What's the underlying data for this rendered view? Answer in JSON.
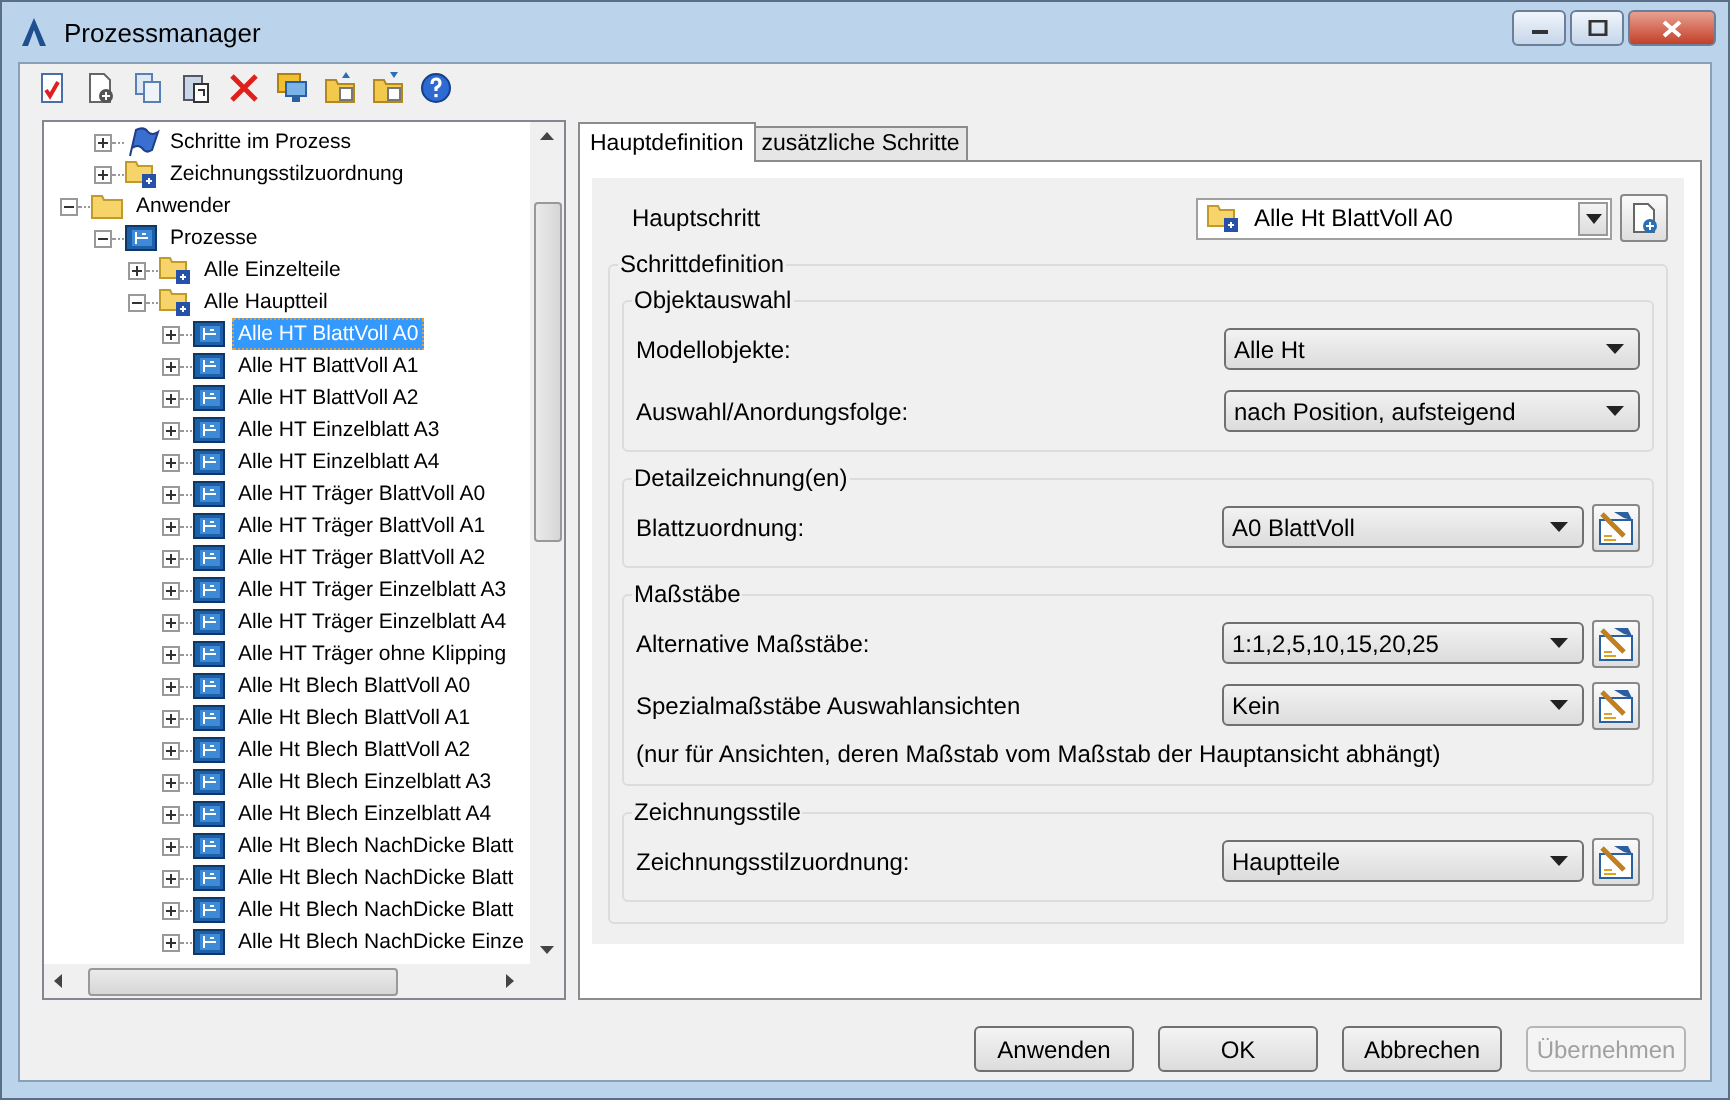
{
  "window": {
    "title": "Prozessmanager"
  },
  "toolbar": [
    {
      "kind": "check"
    },
    {
      "kind": "new"
    },
    {
      "kind": "copy"
    },
    {
      "kind": "paste"
    },
    {
      "kind": "delete"
    },
    {
      "kind": "monitor"
    },
    {
      "kind": "export"
    },
    {
      "kind": "import"
    },
    {
      "kind": "help"
    }
  ],
  "tree": {
    "partial_branch": [
      {
        "label": "Schritte im Prozess",
        "kind": "flag",
        "expanded": false,
        "selected": false
      },
      {
        "label": "Zeichnungsstilzuordnung",
        "kind": "folder-doc",
        "expanded": false,
        "selected": false
      }
    ],
    "items": [
      {
        "label": "Anwender",
        "kind": "folder",
        "expanded": true,
        "selected": false,
        "children": [
          {
            "label": "Prozesse",
            "kind": "process",
            "expanded": true,
            "selected": false,
            "children": [
              {
                "label": "Alle Einzelteile",
                "kind": "folder-doc",
                "expanded": false,
                "selected": false
              },
              {
                "label": "Alle Hauptteil",
                "kind": "folder-doc",
                "expanded": true,
                "selected": false,
                "children": [
                  {
                    "label": "Alle HT BlattVoll A0",
                    "kind": "process",
                    "expanded": false,
                    "selected": true
                  },
                  {
                    "label": "Alle HT BlattVoll A1",
                    "kind": "process",
                    "expanded": false,
                    "selected": false
                  },
                  {
                    "label": "Alle HT BlattVoll A2",
                    "kind": "process",
                    "expanded": false,
                    "selected": false
                  },
                  {
                    "label": "Alle HT Einzelblatt A3",
                    "kind": "process",
                    "expanded": false,
                    "selected": false
                  },
                  {
                    "label": "Alle HT Einzelblatt A4",
                    "kind": "process",
                    "expanded": false,
                    "selected": false
                  },
                  {
                    "label": "Alle HT Träger BlattVoll A0",
                    "kind": "process",
                    "expanded": false,
                    "selected": false
                  },
                  {
                    "label": "Alle HT Träger BlattVoll A1",
                    "kind": "process",
                    "expanded": false,
                    "selected": false
                  },
                  {
                    "label": "Alle HT Träger BlattVoll A2",
                    "kind": "process",
                    "expanded": false,
                    "selected": false
                  },
                  {
                    "label": "Alle HT Träger Einzelblatt A3",
                    "kind": "process",
                    "expanded": false,
                    "selected": false
                  },
                  {
                    "label": "Alle HT Träger Einzelblatt A4",
                    "kind": "process",
                    "expanded": false,
                    "selected": false
                  },
                  {
                    "label": "Alle HT Träger ohne Klipping",
                    "kind": "process",
                    "expanded": false,
                    "selected": false
                  },
                  {
                    "label": "Alle Ht Blech BlattVoll A0",
                    "kind": "process",
                    "expanded": false,
                    "selected": false
                  },
                  {
                    "label": "Alle Ht Blech BlattVoll A1",
                    "kind": "process",
                    "expanded": false,
                    "selected": false
                  },
                  {
                    "label": "Alle Ht Blech BlattVoll A2",
                    "kind": "process",
                    "expanded": false,
                    "selected": false
                  },
                  {
                    "label": "Alle Ht Blech Einzelblatt A3",
                    "kind": "process",
                    "expanded": false,
                    "selected": false
                  },
                  {
                    "label": "Alle Ht Blech Einzelblatt A4",
                    "kind": "process",
                    "expanded": false,
                    "selected": false
                  },
                  {
                    "label": "Alle Ht Blech NachDicke Blatt",
                    "kind": "process",
                    "expanded": false,
                    "selected": false
                  },
                  {
                    "label": "Alle Ht Blech NachDicke Blatt",
                    "kind": "process",
                    "expanded": false,
                    "selected": false
                  },
                  {
                    "label": "Alle Ht Blech NachDicke Blatt",
                    "kind": "process",
                    "expanded": false,
                    "selected": false
                  },
                  {
                    "label": "Alle Ht Blech NachDicke Einze",
                    "kind": "process",
                    "expanded": false,
                    "selected": false
                  }
                ]
              }
            ]
          }
        ]
      }
    ]
  },
  "tabs": [
    {
      "label": "Hauptdefinition",
      "selected": true
    },
    {
      "label": "zusätzliche Schritte",
      "selected": false
    }
  ],
  "main_step": {
    "label": "Hauptschritt",
    "value": "Alle Ht BlattVoll A0"
  },
  "step_definition": {
    "title": "Schrittdefinition",
    "groups": [
      {
        "title": "Objektauswahl",
        "rows": [
          {
            "label": "Modellobjekte:",
            "value": "Alle Ht",
            "edit_button": false
          },
          {
            "label": "Auswahl/Anordungsfolge:",
            "value": "nach Position, aufsteigend",
            "edit_button": false
          }
        ]
      },
      {
        "title": "Detailzeichnung(en)",
        "rows": [
          {
            "label": "Blattzuordnung:",
            "value": "A0 BlattVoll",
            "edit_button": true
          }
        ]
      },
      {
        "title": "Maßstäbe",
        "rows": [
          {
            "label": "Alternative Maßstäbe:",
            "value": "1:1,2,5,10,15,20,25",
            "edit_button": true
          },
          {
            "label": "Spezialmaßstäbe Auswahlansichten",
            "value": "Kein",
            "edit_button": true
          }
        ],
        "note": "(nur für Ansichten, deren Maßstab vom Maßstab der Hauptansicht abhängt)"
      },
      {
        "title": "Zeichnungsstile",
        "rows": [
          {
            "label": "Zeichnungsstilzuordnung:",
            "value": "Hauptteile",
            "edit_button": true
          }
        ]
      }
    ]
  },
  "buttons": [
    {
      "label": "Anwenden",
      "disabled": false
    },
    {
      "label": "OK",
      "disabled": false
    },
    {
      "label": "Abbrechen",
      "disabled": false
    },
    {
      "label": "Übernehmen",
      "disabled": true
    }
  ]
}
